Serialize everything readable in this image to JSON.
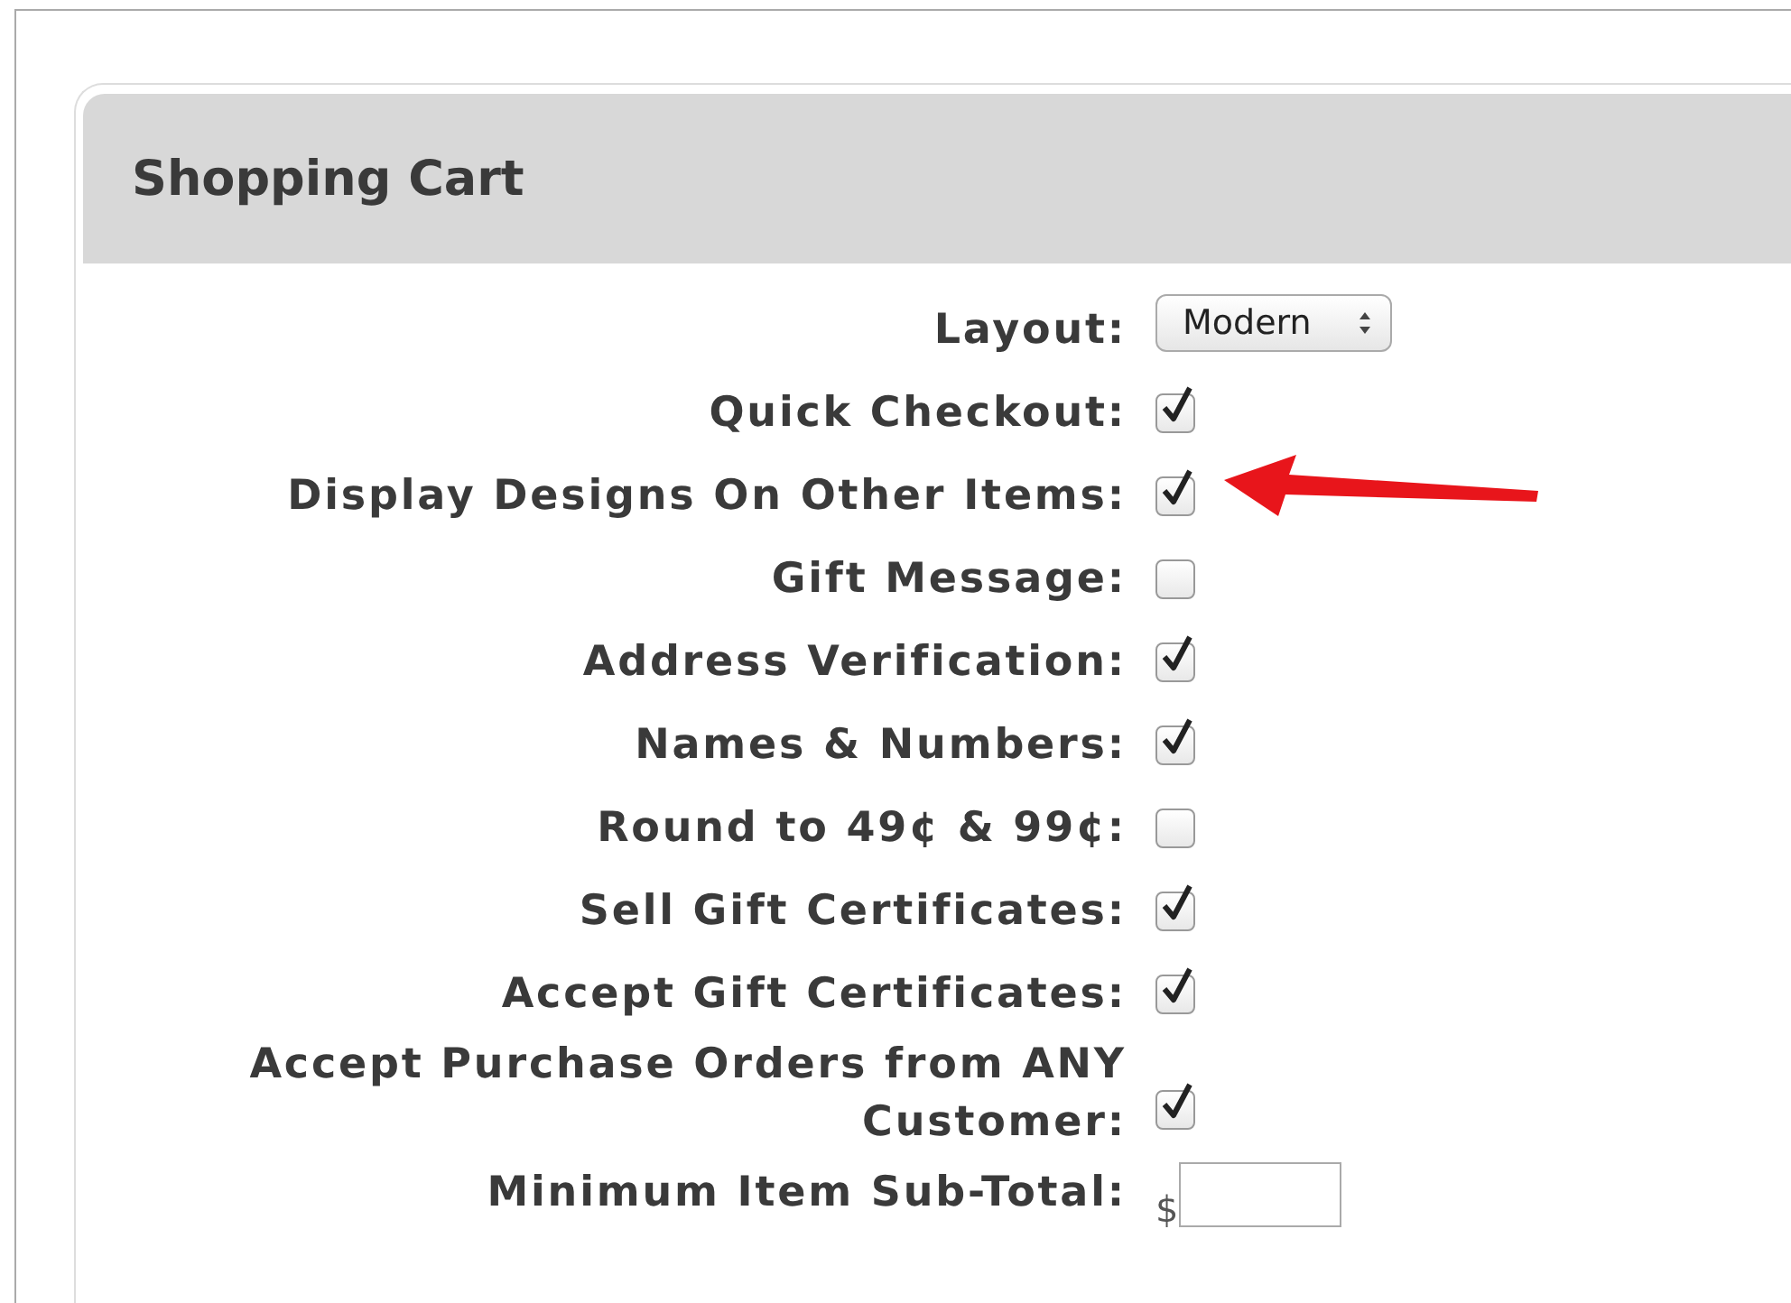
{
  "panel": {
    "title": "Shopping Cart"
  },
  "rows": [
    {
      "kind": "select",
      "label": "Layout:",
      "value": "Modern"
    },
    {
      "kind": "checkbox",
      "label": "Quick Checkout:",
      "checked": true,
      "pointer": false
    },
    {
      "kind": "checkbox",
      "label": "Display Designs On Other Items:",
      "checked": true,
      "pointer": true
    },
    {
      "kind": "checkbox",
      "label": "Gift Message:",
      "checked": false,
      "pointer": false
    },
    {
      "kind": "checkbox",
      "label": "Address Verification:",
      "checked": true,
      "pointer": false
    },
    {
      "kind": "checkbox",
      "label": "Names & Numbers:",
      "checked": true,
      "pointer": false
    },
    {
      "kind": "checkbox",
      "label": "Round to 49¢ & 99¢:",
      "checked": false,
      "pointer": false
    },
    {
      "kind": "checkbox",
      "label": "Sell Gift Certificates:",
      "checked": true,
      "pointer": false
    },
    {
      "kind": "checkbox",
      "label": "Accept Gift Certificates:",
      "checked": true,
      "pointer": false
    },
    {
      "kind": "checkbox",
      "label": "Accept Purchase Orders from ANY Customer:",
      "checked": true,
      "pointer": false
    },
    {
      "kind": "currency",
      "label": "Minimum Item Sub-Total:",
      "symbol": "$"
    }
  ]
}
